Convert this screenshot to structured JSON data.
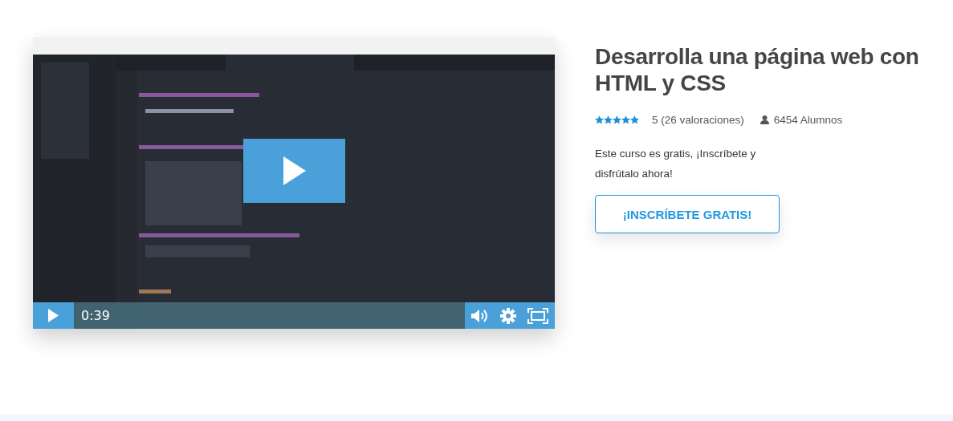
{
  "video": {
    "kind": "picture",
    "time": "0:39"
  },
  "course": {
    "title": "Desarrolla una página web con HTML y CSS",
    "stars": 5,
    "rating": "5 (26 valoraciones)",
    "students": "6454 Alumnos",
    "description": "Este curso es gratis, ¡Inscríbete y disfrútalo ahora!",
    "button": "¡INSCRÍBETE GRATIS!"
  }
}
